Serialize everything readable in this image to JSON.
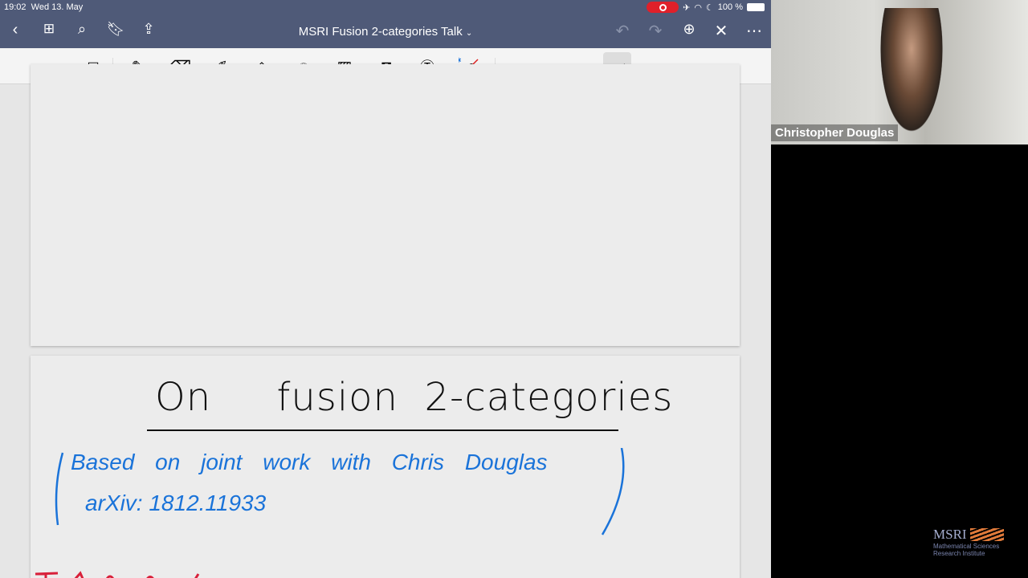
{
  "status": {
    "time": "19:02",
    "date": "Wed 13. May",
    "battery": "100 %"
  },
  "nav": {
    "title": "MSRI Fusion 2-categories Talk",
    "title_chevron": "⌄"
  },
  "page2": {
    "title": "On     fusion  2-categories",
    "note_line1": "Based on joint work with Chris Douglas",
    "note_line2": "arXiv: 1812.11933"
  },
  "video": {
    "participant": "Christopher Douglas"
  },
  "logo": {
    "name": "MSRI",
    "sub1": "Mathematical Sciences",
    "sub2": "Research Institute"
  },
  "colors": {
    "bar": "#4f5a78",
    "ink_blue": "#1a73d9",
    "ink_red": "#d8203a"
  }
}
